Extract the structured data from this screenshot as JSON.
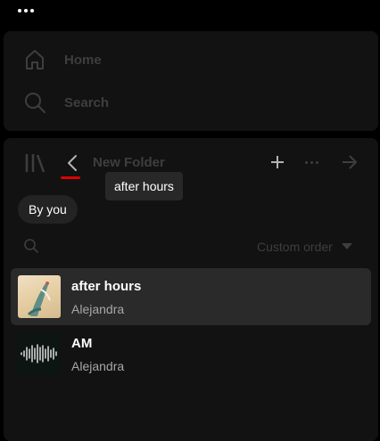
{
  "top_menu": {
    "icon": "more-dots-icon"
  },
  "nav": {
    "home_label": "Home",
    "search_label": "Search"
  },
  "library": {
    "folder_title": "New Folder",
    "tooltip": "after hours",
    "filter_chip": "By you",
    "sort_label": "Custom order",
    "items": [
      {
        "title": "after hours",
        "subtitle": "Alejandra",
        "active": true
      },
      {
        "title": "AM",
        "subtitle": "Alejandra",
        "active": false
      }
    ]
  },
  "colors": {
    "panel": "#121212",
    "dim_text": "#3e3e3e",
    "secondary_text": "#a7a7a7",
    "active_row": "#2a2a2a",
    "underline_red": "#e00000"
  }
}
